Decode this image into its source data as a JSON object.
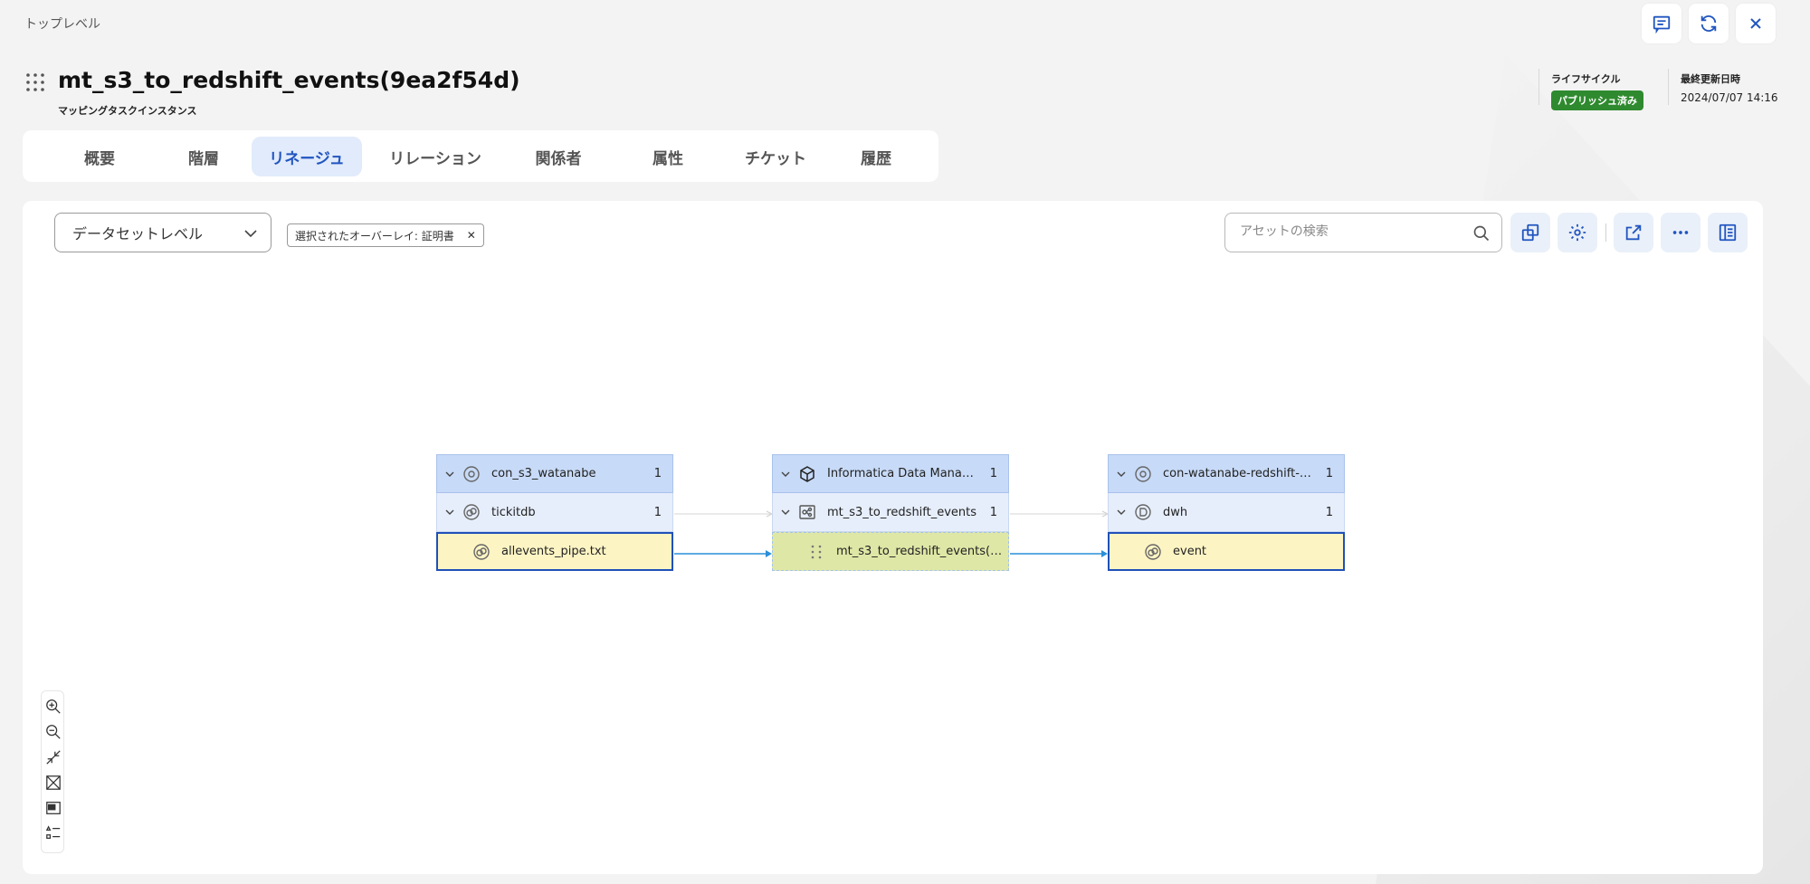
{
  "breadcrumb": "トップレベル",
  "header": {
    "title": "mt_s3_to_redshift_events(9ea2f54d)",
    "subtitle": "マッピングタスクインスタンス",
    "lifecycle_label": "ライフサイクル",
    "lifecycle_value": "パブリッシュ済み",
    "updated_label": "最終更新日時",
    "updated_value": "2024/07/07 14:16",
    "actions": [
      "comment-icon",
      "refresh-icon",
      "close-icon"
    ]
  },
  "tabs": [
    {
      "label": "概要"
    },
    {
      "label": "階層"
    },
    {
      "label": "リネージュ",
      "active": true
    },
    {
      "label": "リレーション"
    },
    {
      "label": "関係者"
    },
    {
      "label": "属性"
    },
    {
      "label": "チケット"
    },
    {
      "label": "履歴"
    }
  ],
  "toolbar": {
    "level_select": "データセットレベル",
    "overlay_chip": "選択されたオーバーレイ: 証明書",
    "search_placeholder": "アセットの検索",
    "buttons": [
      "copy-icon",
      "settings-icon",
      "open-external-icon",
      "more-icon",
      "panel-icon"
    ]
  },
  "lineage": {
    "nodes": [
      {
        "header": {
          "label": "con_s3_watanabe",
          "count": "1"
        },
        "group": {
          "label": "tickitdb",
          "count": "1"
        },
        "leaf": {
          "label": "allevents_pipe.txt"
        }
      },
      {
        "header": {
          "label": "Informatica Data Managem...",
          "count": "1"
        },
        "group": {
          "label": "mt_s3_to_redshift_events",
          "count": "1"
        },
        "leaf": {
          "label": "mt_s3_to_redshift_events(9..."
        }
      },
      {
        "header": {
          "label": "con-watanabe-redshift-serve...",
          "count": "1"
        },
        "group": {
          "label": "dwh",
          "count": "1"
        },
        "leaf": {
          "label": "event"
        }
      }
    ]
  },
  "zoom_controls": [
    "zoom-in-icon",
    "zoom-out-icon",
    "collapse-icon",
    "fit-icon",
    "minimap-icon",
    "legend-icon"
  ],
  "colors": {
    "accent": "#2155c0",
    "badge": "#2f8a2f",
    "edge": "#2a8fd8",
    "leaf_fill": "#fdf4c4",
    "process_fill": "#dfe7a6"
  }
}
